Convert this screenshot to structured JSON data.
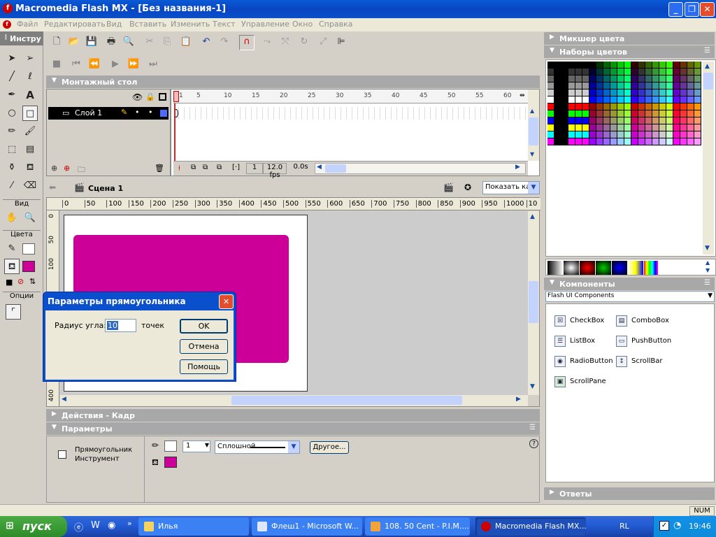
{
  "window": {
    "title": "Macromedia Flash MX - [Без названия-1]"
  },
  "menu": [
    "Файл",
    "Редактировать",
    "Вид",
    "Вставить",
    "Изменить",
    "Текст",
    "Управление",
    "Окно",
    "Справка"
  ],
  "tools_panel": {
    "title": "Инстру",
    "view_label": "Вид",
    "colors_label": "Цвета",
    "options_label": "Опции"
  },
  "timeline": {
    "title": "Монтажный стол",
    "frame_ticks": [
      "1",
      "5",
      "10",
      "15",
      "20",
      "25",
      "30",
      "35",
      "40",
      "45",
      "50",
      "55",
      "60"
    ],
    "layer_name": "Слой 1",
    "current_frame": "1",
    "fps": "12.0 fps",
    "elapsed": "0.0s"
  },
  "scene": {
    "name": "Сцена 1",
    "zoom_value": "Показать ка"
  },
  "ruler": {
    "h_ticks": [
      "0",
      "50",
      "100",
      "150",
      "200",
      "250",
      "300",
      "350",
      "400",
      "450",
      "500",
      "550",
      "600",
      "650",
      "700",
      "750",
      "800",
      "850",
      "900",
      "950",
      "1000",
      "10"
    ],
    "v_ticks": [
      "0",
      "50",
      "100",
      "400"
    ]
  },
  "canvas": {
    "rect_color": "#cc0099",
    "stage_color": "#ffffff",
    "workspace_color": "#cccccc"
  },
  "dialog": {
    "title": "Параметры прямоугольника",
    "radius_label": "Радиус угла:",
    "radius_value": "10",
    "units": "точек",
    "ok": "OK",
    "cancel": "Отмена",
    "help": "Помощь"
  },
  "actions_panel": {
    "title": "Действия - Кадр"
  },
  "props_panel": {
    "title": "Параметры",
    "tool_name_line1": "Прямоугольник",
    "tool_name_line2": "Инструмент",
    "stroke_width": "1",
    "stroke_style": "Сплошной",
    "other_button": "Другое...",
    "fill_color": "#cc0099"
  },
  "right_panels": {
    "color_mixer": "Микшер цвета",
    "color_swatches": "Наборы цветов",
    "components": "Компоненты",
    "components_set": "Flash UI Components",
    "answers": "Ответы"
  },
  "components": [
    "CheckBox",
    "ComboBox",
    "ListBox",
    "PushButton",
    "RadioButton",
    "ScrollBar",
    "ScrollPane"
  ],
  "status": {
    "num": "NUM"
  },
  "taskbar": {
    "start": "пуск",
    "tasks": [
      "Илья",
      "Флеш1 - Microsoft W...",
      "108. 50 Cent - P.I.M....",
      "Macromedia Flash MX..."
    ],
    "lang": "RL",
    "clock": "19:46"
  }
}
